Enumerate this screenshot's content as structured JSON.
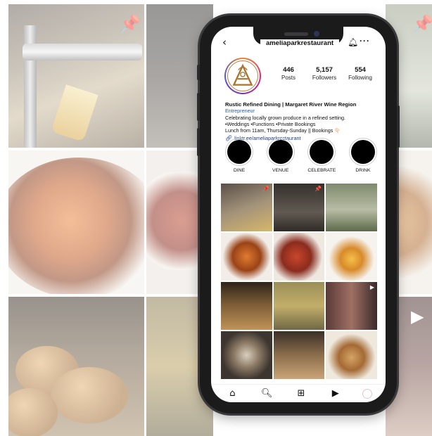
{
  "profile": {
    "username": "ameliaparkrestaurant",
    "stats": [
      {
        "value": "446",
        "label": "Posts"
      },
      {
        "value": "5,157",
        "label": "Followers"
      },
      {
        "value": "554",
        "label": "Following"
      }
    ],
    "bio": {
      "title": "Rustic Refined Dining | Margaret River Wine Region",
      "category": "Entrepreneur",
      "line1": "Celebrating locally grown produce in a refined setting.",
      "line2": "•Weddings •Functions •Private Bookings",
      "line3": "Lunch from 11am, Thursday-Sunday || Bookings 👇🏻",
      "link": "linktr.ee/ameliaparkrestaurant"
    }
  },
  "highlights": [
    {
      "label": "DINE"
    },
    {
      "label": "VENUE"
    },
    {
      "label": "CELEBRATE"
    },
    {
      "label": "DRINK"
    }
  ],
  "icons": {
    "back": "back-arrow-icon",
    "bell": "bell-icon",
    "more": "more-icon",
    "link": "link-icon",
    "nav": [
      "home-icon",
      "search-icon",
      "new-post-icon",
      "reels-icon",
      "profile-avatar"
    ]
  },
  "colors": {
    "link": "#1a3e8a",
    "category": "#2a5db0",
    "phone_frame": "#1b1b1c"
  }
}
